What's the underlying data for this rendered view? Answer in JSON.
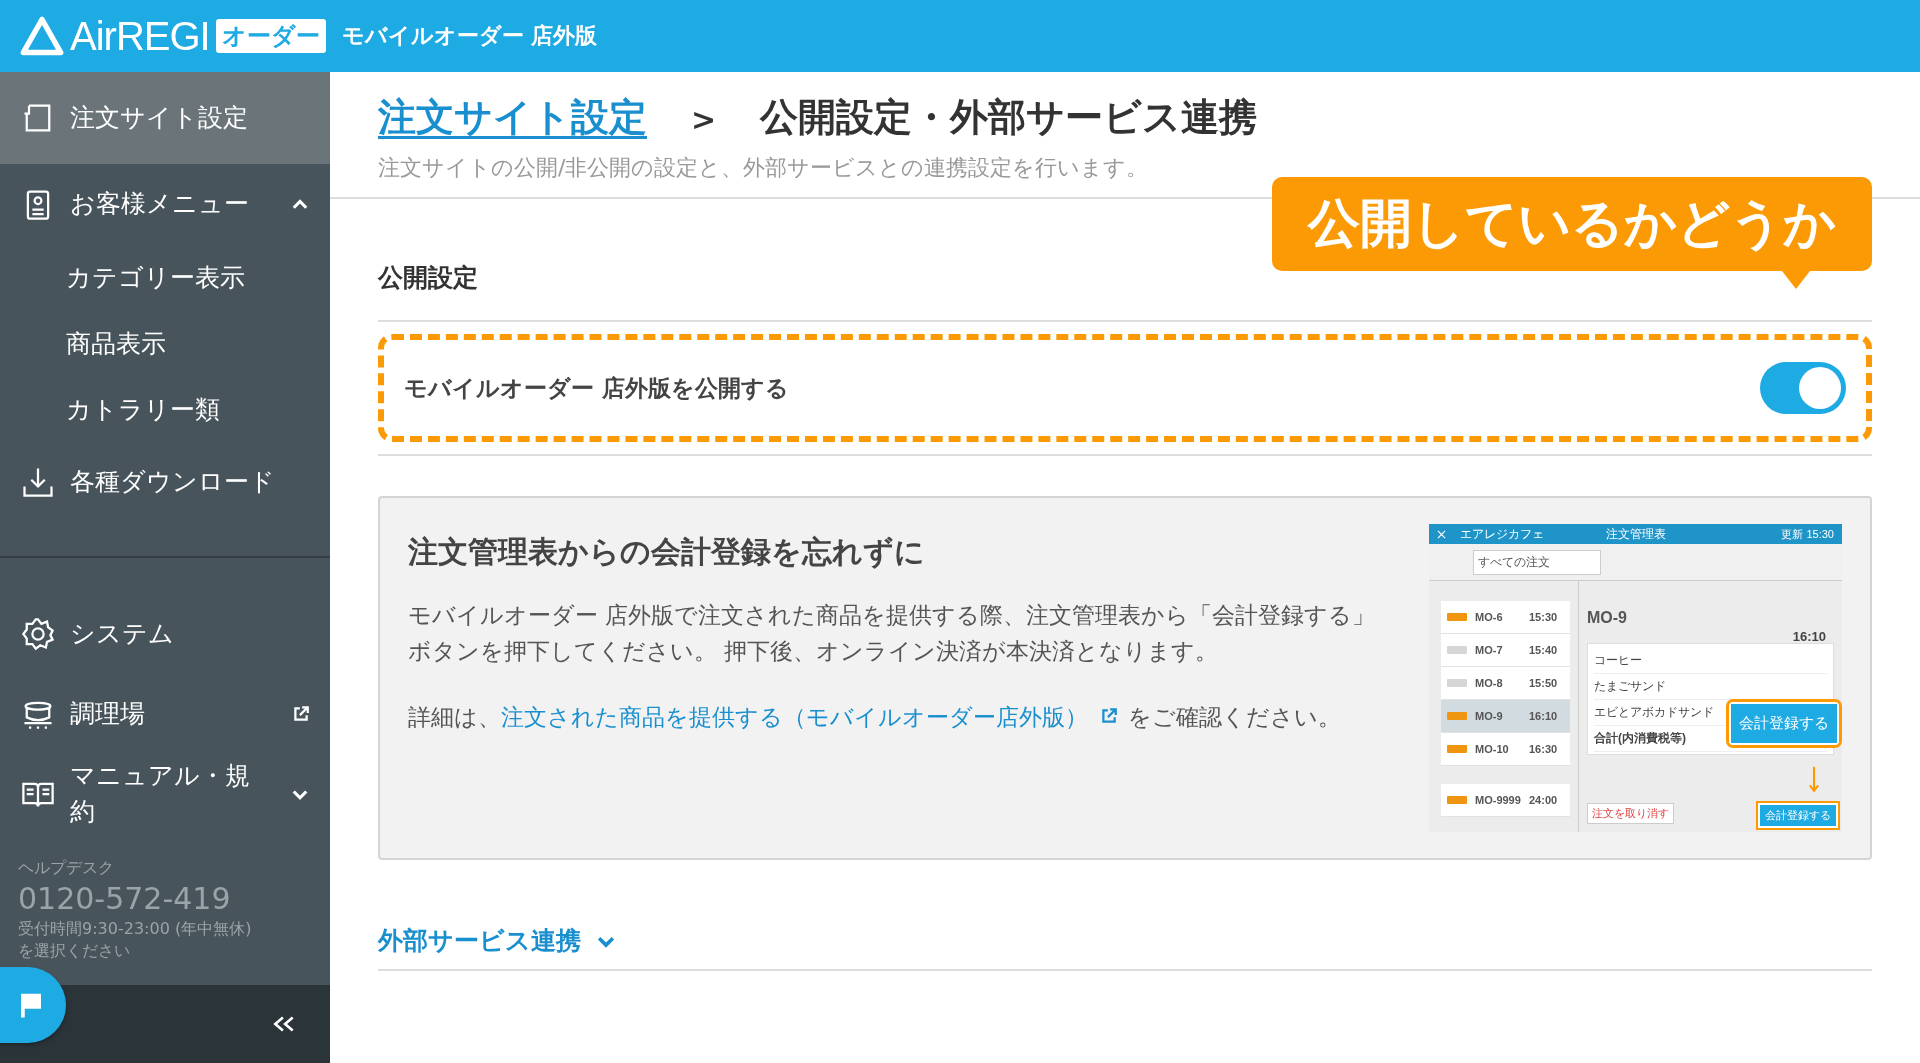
{
  "header": {
    "logo": "AirREGI",
    "badge": "オーダー",
    "title": "モバイルオーダー 店外版"
  },
  "sidebar": {
    "items": [
      {
        "kind": "link",
        "label": "注文サイト設定",
        "selected": true
      },
      {
        "kind": "group",
        "label": "お客様メニュー",
        "selected": false,
        "expanded": true,
        "children": [
          {
            "label": "カテゴリー表示",
            "selected": false
          },
          {
            "label": "商品表示",
            "selected": false
          },
          {
            "label": "カトラリー類",
            "selected": false
          }
        ]
      },
      {
        "kind": "link",
        "label": "各種ダウンロード",
        "selected": false
      }
    ],
    "bottom_items": [
      {
        "kind": "link",
        "label": "システム",
        "selected": false
      },
      {
        "kind": "external",
        "label": "調理場",
        "selected": false
      },
      {
        "kind": "group",
        "label": "マニュアル・規約",
        "selected": false,
        "expanded": false
      }
    ],
    "helpdesk": {
      "label": "ヘルプデスク",
      "phone": "0120-572-419",
      "hours": "受付時間9:30-23:00 (年中無休)",
      "note": "を選択ください"
    }
  },
  "breadcrumb": {
    "parent": "注文サイト設定",
    "separator": ">",
    "current": "公開設定・外部サービス連携"
  },
  "description": "注文サイトの公開/非公開の設定と、外部サービスとの連携設定を行います。",
  "callout": "公開しているかどうか",
  "publish": {
    "heading": "公開設定",
    "label": "モバイルオーダー 店外版を公開する",
    "on": true
  },
  "notice": {
    "heading": "注文管理表からの会計登録を忘れずに",
    "body": "モバイルオーダー 店外版で注文された商品を提供する際、注文管理表から「会計登録する」ボタンを押下してください。 押下後、オンライン決済が本決済となります。",
    "detail_prefix": "詳細は、",
    "link": "注文された商品を提供する（モバイルオーダー店外版）",
    "detail_suffix": "をご確認ください。",
    "screenshot": {
      "shop": "エアレジカフェ",
      "title": "注文管理表",
      "refresh": "更新 15:30",
      "filter": "すべての注文",
      "orders": [
        {
          "id": "MO-6",
          "time": "15:30",
          "color": "#f0950f",
          "selected": false
        },
        {
          "id": "MO-7",
          "time": "15:40",
          "color": "#d6d6d6",
          "selected": false
        },
        {
          "id": "MO-8",
          "time": "15:50",
          "color": "#d6d6d6",
          "selected": false
        },
        {
          "id": "MO-9",
          "time": "16:10",
          "color": "#f0950f",
          "selected": true
        },
        {
          "id": "MO-10",
          "time": "16:30",
          "color": "#f0950f",
          "selected": false
        },
        {
          "id": "MO-9999",
          "time": "24:00",
          "color": "#f0950f",
          "selected": false
        }
      ],
      "detail": {
        "id": "MO-9",
        "time": "16:10",
        "items": [
          "コーヒー",
          "たまごサンド",
          "エビとアボカドサンド"
        ],
        "total_label": "合計(内消費税等)",
        "cancel": "注文を取り消す"
      },
      "highlight_button": "会計登録する",
      "button": "会計登録する"
    }
  },
  "external": {
    "label": "外部サービス連携",
    "expanded": false
  }
}
